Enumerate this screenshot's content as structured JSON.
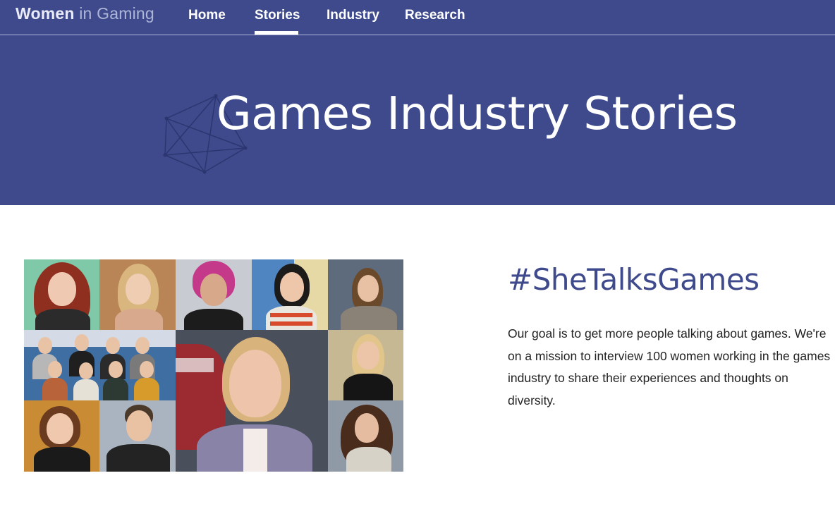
{
  "nav": {
    "brand_bold": "Women",
    "brand_light": " in Gaming",
    "items": [
      {
        "label": "Home"
      },
      {
        "label": "Stories"
      },
      {
        "label": "Industry"
      },
      {
        "label": "Research"
      }
    ],
    "active_item": "Stories"
  },
  "hero": {
    "title": "Games Industry Stories"
  },
  "main": {
    "heading": "#SheTalksGames",
    "description": "Our goal is to get more people talking about games. We're on a mission to interview 100 women working in the games industry to share their experiences and thoughts on diversity."
  },
  "colors": {
    "brand_blue": "#3e4a8c",
    "white": "#ffffff",
    "text": "#222222"
  },
  "icons": {
    "hero_graphic": "polygon-network-icon"
  }
}
